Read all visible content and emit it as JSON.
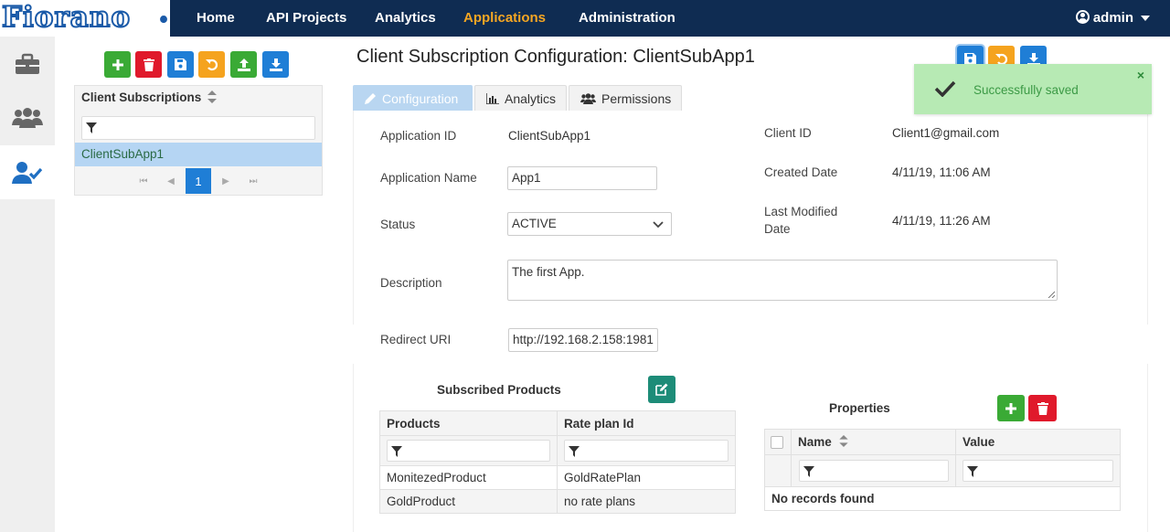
{
  "brand": {
    "logo_text": "Fiorano"
  },
  "nav": {
    "items": [
      {
        "label": "Home"
      },
      {
        "label": "API Projects"
      },
      {
        "label": "Analytics"
      },
      {
        "label": "Applications"
      },
      {
        "label": "Administration"
      }
    ],
    "active": "Applications",
    "user_label": "admin"
  },
  "rail": {
    "items": [
      {
        "icon": "briefcase-icon"
      },
      {
        "icon": "users-icon"
      },
      {
        "icon": "user-check-icon",
        "active": true
      }
    ]
  },
  "subscriptions": {
    "toolbar": [
      "add",
      "delete",
      "save",
      "undo",
      "upload",
      "download"
    ],
    "header": "Client Subscriptions",
    "rows": [
      {
        "name": "ClientSubApp1",
        "selected": true
      }
    ],
    "pager": {
      "current_page": "1"
    }
  },
  "main": {
    "title": "Client Subscription Configuration: ClientSubApp1",
    "tabs": [
      {
        "label": "Configuration",
        "active": true
      },
      {
        "label": "Analytics"
      },
      {
        "label": "Permissions"
      }
    ],
    "form": {
      "application_id_label": "Application ID",
      "application_id": "ClientSubApp1",
      "application_name_label": "Application Name",
      "application_name": "App1",
      "status_label": "Status",
      "status": "ACTIVE",
      "description_label": "Description",
      "description": "The first App.",
      "redirect_uri_label": "Redirect URI",
      "redirect_uri": "http://192.168.2.158:1981",
      "client_id_label": "Client ID",
      "client_id": "Client1@gmail.com",
      "created_date_label": "Created Date",
      "created_date": "4/11/19, 11:06 AM",
      "last_modified_label_1": "Last Modified",
      "last_modified_label_2": "Date",
      "last_modified": "4/11/19, 11:26 AM"
    },
    "subscribed_products": {
      "title": "Subscribed Products",
      "columns": [
        "Products",
        "Rate plan Id"
      ],
      "rows": [
        [
          "MonitezedProduct",
          "GoldRatePlan"
        ],
        [
          "GoldProduct",
          "no rate plans"
        ]
      ]
    },
    "properties": {
      "title": "Properties",
      "columns": [
        "Name",
        "Value"
      ],
      "empty_text": "No records found"
    }
  },
  "toast": {
    "message": "Successfully saved"
  },
  "colors": {
    "nav_bg": "#0f2c52",
    "accent": "#f5a623",
    "primary": "#1f7ed6",
    "success_bg": "#b7eab4"
  }
}
